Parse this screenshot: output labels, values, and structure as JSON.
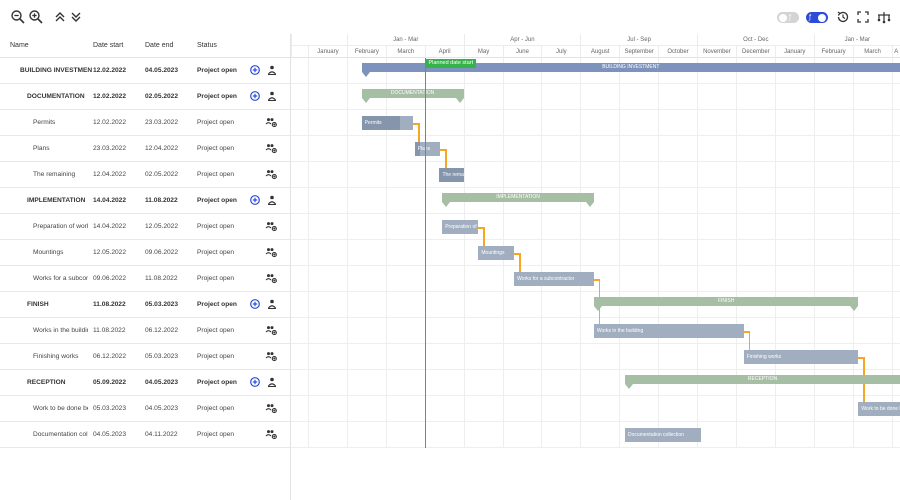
{
  "colors": {
    "accent": "#2c4bd6",
    "today": "#36b24a",
    "dependency": "#f5a623",
    "task_bar": "#a0aec0",
    "investment_bar": "#7d93bd",
    "phase_bar": "#a5bea4"
  },
  "toolbar": {
    "left_icons": [
      "zoom-out-icon",
      "zoom-in-icon",
      "collapse-all-icon",
      "expand-all-icon"
    ],
    "right_icons": [
      "toggle-off",
      "toggle-on",
      "history-icon",
      "fullscreen-icon",
      "critical-path-icon"
    ]
  },
  "grid": {
    "columns": [
      "Name",
      "Date start",
      "Date end",
      "Status"
    ],
    "rows": [
      {
        "name": "BUILDING INVESTMENT",
        "start": "12.02.2022",
        "end": "04.05.2023",
        "status": "Project open",
        "bold": true,
        "level": 0,
        "add": true
      },
      {
        "name": "DOCUMENTATION",
        "start": "12.02.2022",
        "end": "02.05.2022",
        "status": "Project open",
        "bold": true,
        "level": 1,
        "add": true
      },
      {
        "name": "Permits",
        "start": "12.02.2022",
        "end": "23.03.2022",
        "status": "Project open",
        "bold": false,
        "level": 2,
        "add": false
      },
      {
        "name": "Plans",
        "start": "23.03.2022",
        "end": "12.04.2022",
        "status": "Project open",
        "bold": false,
        "level": 2,
        "add": false
      },
      {
        "name": "The remaining",
        "start": "12.04.2022",
        "end": "02.05.2022",
        "status": "Project open",
        "bold": false,
        "level": 2,
        "add": false
      },
      {
        "name": "IMPLEMENTATION",
        "start": "14.04.2022",
        "end": "11.08.2022",
        "status": "Project open",
        "bold": true,
        "level": 1,
        "add": true
      },
      {
        "name": "Preparation of work",
        "start": "14.04.2022",
        "end": "12.05.2022",
        "status": "Project open",
        "bold": false,
        "level": 2,
        "add": false
      },
      {
        "name": "Mountings",
        "start": "12.05.2022",
        "end": "09.06.2022",
        "status": "Project open",
        "bold": false,
        "level": 2,
        "add": false
      },
      {
        "name": "Works for a subcont",
        "start": "09.06.2022",
        "end": "11.08.2022",
        "status": "Project open",
        "bold": false,
        "level": 2,
        "add": false
      },
      {
        "name": "FINISH",
        "start": "11.08.2022",
        "end": "05.03.2023",
        "status": "Project open",
        "bold": true,
        "level": 1,
        "add": true
      },
      {
        "name": "Works in the buildin",
        "start": "11.08.2022",
        "end": "06.12.2022",
        "status": "Project open",
        "bold": false,
        "level": 2,
        "add": false
      },
      {
        "name": "Finishing works",
        "start": "06.12.2022",
        "end": "05.03.2023",
        "status": "Project open",
        "bold": false,
        "level": 2,
        "add": false
      },
      {
        "name": "RECEPTION",
        "start": "05.09.2022",
        "end": "04.05.2023",
        "status": "Project open",
        "bold": true,
        "level": 1,
        "add": true
      },
      {
        "name": "Work to be done be",
        "start": "05.03.2023",
        "end": "04.05.2023",
        "status": "Project open",
        "bold": false,
        "level": 2,
        "add": false
      },
      {
        "name": "Documentation colle",
        "start": "04.05.2023",
        "end": "04.11.2022",
        "status": "Project open",
        "bold": false,
        "level": 2,
        "add": false
      }
    ]
  },
  "timeline": {
    "quarters": [
      "",
      "Jan - Mar",
      "Apr - Jun",
      "Jul - Sep",
      "Oct - Dec",
      "Jan - Mar",
      ""
    ],
    "months": [
      "January",
      "February",
      "March",
      "April",
      "May",
      "June",
      "July",
      "August",
      "September",
      "October",
      "November",
      "December",
      "January",
      "February",
      "March",
      "A"
    ],
    "today_label": "Planned date start",
    "bars": [
      {
        "row": 0,
        "label": "BUILDING INVESTMENT",
        "kind": "summary",
        "color": "#7d93bd",
        "start": 1.38,
        "end": 16.5,
        "progress": 0.0
      },
      {
        "row": 1,
        "label": "DOCUMENTATION",
        "kind": "summary",
        "color": "#a5bea4",
        "start": 1.38,
        "end": 4.0,
        "progress": 0.0
      },
      {
        "row": 2,
        "label": "Permits",
        "kind": "task",
        "start": 1.38,
        "end": 2.7,
        "progress": 0.75
      },
      {
        "row": 3,
        "label": "Plans",
        "kind": "task",
        "start": 2.74,
        "end": 3.4,
        "progress": 0.2
      },
      {
        "row": 4,
        "label": "The remaining",
        "kind": "task",
        "start": 3.38,
        "end": 4.0,
        "progress": 1.0
      },
      {
        "row": 5,
        "label": "IMPLEMENTATION",
        "kind": "summary",
        "color": "#a5bea4",
        "start": 3.45,
        "end": 7.35,
        "progress": 0.0
      },
      {
        "row": 6,
        "label": "Preparation of work",
        "kind": "task",
        "start": 3.45,
        "end": 4.38,
        "progress": 0.0
      },
      {
        "row": 7,
        "label": "Mountings",
        "kind": "task",
        "start": 4.38,
        "end": 5.3,
        "progress": 0.0
      },
      {
        "row": 8,
        "label": "Works for a subcontractor",
        "kind": "task",
        "start": 5.3,
        "end": 7.35,
        "progress": 0.0
      },
      {
        "row": 9,
        "label": "FINISH",
        "kind": "summary",
        "color": "#a5bea4",
        "start": 7.35,
        "end": 14.15,
        "progress": 0.0
      },
      {
        "row": 10,
        "label": "Works in the building",
        "kind": "task",
        "start": 7.35,
        "end": 11.2,
        "progress": 0.0
      },
      {
        "row": 11,
        "label": "Finishing works",
        "kind": "task",
        "start": 11.2,
        "end": 14.15,
        "progress": 0.0
      },
      {
        "row": 12,
        "label": "RECEPTION",
        "kind": "summary",
        "color": "#a5bea4",
        "start": 8.15,
        "end": 16.5,
        "progress": 0.0
      },
      {
        "row": 13,
        "label": "Work to be done before acceptance",
        "kind": "task",
        "start": 14.15,
        "end": 16.5,
        "progress": 0.0
      },
      {
        "row": 14,
        "label": "Documentation collection",
        "kind": "task",
        "start": 8.15,
        "end": 10.1,
        "progress": 0.0
      }
    ],
    "today_month": 3.02
  }
}
